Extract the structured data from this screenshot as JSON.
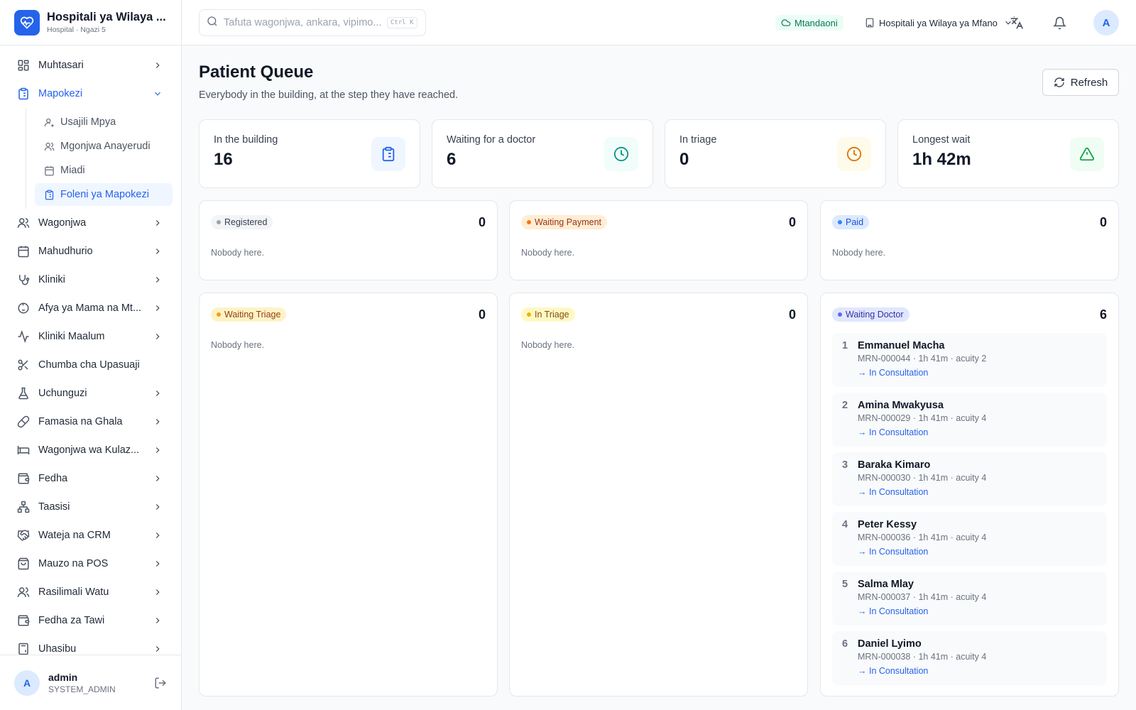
{
  "brand": {
    "title": "Hospitali ya Wilaya ...",
    "subtitle": "Hospital · Ngazi 5"
  },
  "nav": {
    "items": [
      {
        "label": "Muhtasari",
        "icon": "dashboard-icon"
      },
      {
        "label": "Mapokezi",
        "icon": "clipboard-icon",
        "expanded": true
      },
      {
        "label": "Wagonjwa",
        "icon": "users-icon"
      },
      {
        "label": "Mahudhurio",
        "icon": "calendar-icon"
      },
      {
        "label": "Kliniki",
        "icon": "stethoscope-icon"
      },
      {
        "label": "Afya ya Mama na Mt...",
        "icon": "baby-icon"
      },
      {
        "label": "Kliniki Maalum",
        "icon": "activity-icon"
      },
      {
        "label": "Chumba cha Upasuaji",
        "icon": "scissors-icon"
      },
      {
        "label": "Uchunguzi",
        "icon": "flask-icon"
      },
      {
        "label": "Famasia na Ghala",
        "icon": "pill-icon"
      },
      {
        "label": "Wagonjwa wa Kulaz...",
        "icon": "bed-icon"
      },
      {
        "label": "Fedha",
        "icon": "wallet-icon"
      },
      {
        "label": "Taasisi",
        "icon": "network-icon"
      },
      {
        "label": "Wateja na CRM",
        "icon": "handshake-icon"
      },
      {
        "label": "Mauzo na POS",
        "icon": "shopping-bag-icon"
      },
      {
        "label": "Rasilimali Watu",
        "icon": "user-icon"
      },
      {
        "label": "Fedha za Tawi",
        "icon": "wallet-icon"
      },
      {
        "label": "Uhasibu",
        "icon": "calculator-icon"
      }
    ],
    "sub_items": [
      {
        "label": "Usajili Mpya",
        "icon": "user-plus-icon"
      },
      {
        "label": "Mgonjwa Anayerudi",
        "icon": "users-icon"
      },
      {
        "label": "Miadi",
        "icon": "calendar-icon"
      },
      {
        "label": "Foleni ya Mapokezi",
        "icon": "clipboard-icon",
        "active": true
      }
    ]
  },
  "user": {
    "initial": "A",
    "name": "admin",
    "role": "SYSTEM_ADMIN"
  },
  "header": {
    "search_placeholder": "Tafuta wagonjwa, ankara, vipimo...",
    "search_shortcut": "Ctrl K",
    "status": "Mtandaoni",
    "facility": "Hospitali ya Wilaya ya Mfano",
    "avatar": "A"
  },
  "page": {
    "title": "Patient Queue",
    "subtitle": "Everybody in the building, at the step they have reached.",
    "refresh_label": "Refresh"
  },
  "stats": [
    {
      "label": "In the building",
      "value": "16"
    },
    {
      "label": "Waiting for a doctor",
      "value": "6"
    },
    {
      "label": "In triage",
      "value": "0"
    },
    {
      "label": "Longest wait",
      "value": "1h 42m"
    }
  ],
  "columns": [
    {
      "status": "Registered",
      "count": "0",
      "empty": "Nobody here."
    },
    {
      "status": "Waiting Payment",
      "count": "0",
      "empty": "Nobody here."
    },
    {
      "status": "Paid",
      "count": "0",
      "empty": "Nobody here."
    },
    {
      "status": "Waiting Triage",
      "count": "0",
      "empty": "Nobody here."
    },
    {
      "status": "In Triage",
      "count": "0",
      "empty": "Nobody here."
    },
    {
      "status": "Waiting Doctor",
      "count": "6"
    }
  ],
  "waiting_doctor": [
    {
      "num": "1",
      "name": "Emmanuel Macha",
      "meta": "MRN-000044 · 1h 41m · acuity 2",
      "next": "→ In Consultation"
    },
    {
      "num": "2",
      "name": "Amina Mwakyusa",
      "meta": "MRN-000029 · 1h 41m · acuity 4",
      "next": "→ In Consultation"
    },
    {
      "num": "3",
      "name": "Baraka Kimaro",
      "meta": "MRN-000030 · 1h 41m · acuity 4",
      "next": "→ In Consultation"
    },
    {
      "num": "4",
      "name": "Peter Kessy",
      "meta": "MRN-000036 · 1h 41m · acuity 4",
      "next": "→ In Consultation"
    },
    {
      "num": "5",
      "name": "Salma Mlay",
      "meta": "MRN-000037 · 1h 41m · acuity 4",
      "next": "→ In Consultation"
    },
    {
      "num": "6",
      "name": "Daniel Lyimo",
      "meta": "MRN-000038 · 1h 41m · acuity 4",
      "next": "→ In Consultation"
    }
  ],
  "colors": {
    "primary": "#2563eb",
    "success": "#047857",
    "warning": "#d97706",
    "muted": "#6b7280"
  }
}
